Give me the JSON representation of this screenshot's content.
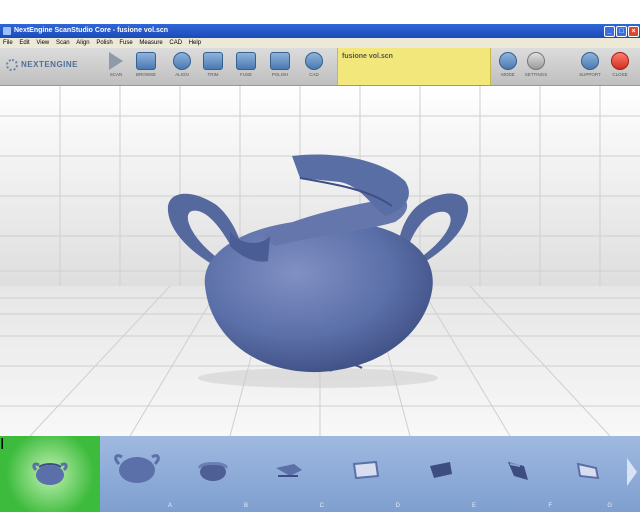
{
  "window": {
    "title": "NextEngine ScanStudio Core - fusione vol.scn"
  },
  "menu": [
    "File",
    "Edit",
    "View",
    "Scan",
    "Align",
    "Polish",
    "Fuse",
    "Measure",
    "CAD",
    "Help"
  ],
  "toolbar": {
    "logo": "NEXTENGINE",
    "buttons": [
      {
        "label": "Scan",
        "icon": "play-icon"
      },
      {
        "label": "Browse",
        "icon": "folder-icon"
      },
      {
        "label": "Align",
        "icon": "align-icon"
      },
      {
        "label": "Trim",
        "icon": "trim-icon"
      },
      {
        "label": "Fuse",
        "icon": "cube-icon"
      },
      {
        "label": "Polish",
        "icon": "polish-icon"
      },
      {
        "label": "CAD",
        "icon": "globe-icon"
      }
    ],
    "file_name": "fusione vol.scn",
    "right_buttons": [
      {
        "label": "Mode",
        "icon": "mode-icon"
      },
      {
        "label": "Settings",
        "icon": "settings-icon"
      },
      {
        "label": "Support",
        "icon": "help-icon"
      },
      {
        "label": "Close",
        "icon": "close-icon"
      }
    ]
  },
  "thumbnails": [
    {
      "label": "I"
    },
    {
      "label": "A"
    },
    {
      "label": "B"
    },
    {
      "label": "C"
    },
    {
      "label": "D"
    },
    {
      "label": "E"
    },
    {
      "label": "F"
    },
    {
      "label": "G"
    }
  ],
  "colors": {
    "model": "#5b6fa8",
    "active_thumb": "#3dbb3d",
    "file_panel": "#f2e77a"
  }
}
